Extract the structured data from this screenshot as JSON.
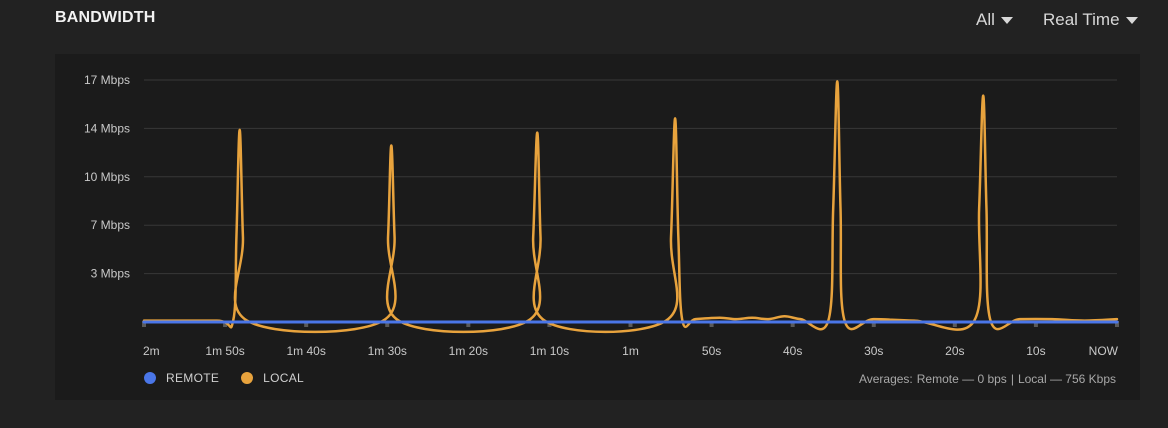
{
  "header": {
    "title": "BANDWIDTH",
    "filter_label": "All",
    "range_label": "Real Time"
  },
  "legend": {
    "remote_label": "REMOTE",
    "local_label": "LOCAL"
  },
  "averages": {
    "prefix": "Averages:",
    "remote": "Remote — 0 bps",
    "separator": "|",
    "local": "Local — 756 Kbps"
  },
  "colors": {
    "remote": "#4a76e8",
    "local": "#e8a33d",
    "grid": "#383838",
    "tick_text": "#c9c9c9"
  },
  "chart_data": {
    "type": "line",
    "xlabel": "",
    "ylabel": "",
    "x_unit": "seconds ago",
    "xlim": [
      120,
      0
    ],
    "ylim": [
      0,
      17
    ],
    "y_ticks": [
      {
        "value": 3.4,
        "label": "3 Mbps"
      },
      {
        "value": 6.8,
        "label": "7 Mbps"
      },
      {
        "value": 10.2,
        "label": "10 Mbps"
      },
      {
        "value": 13.6,
        "label": "14 Mbps"
      },
      {
        "value": 17,
        "label": "17 Mbps"
      }
    ],
    "x_ticks": [
      {
        "value": 120,
        "label": "2m"
      },
      {
        "value": 110,
        "label": "1m 50s"
      },
      {
        "value": 100,
        "label": "1m 40s"
      },
      {
        "value": 90,
        "label": "1m 30s"
      },
      {
        "value": 80,
        "label": "1m 20s"
      },
      {
        "value": 70,
        "label": "1m 10s"
      },
      {
        "value": 60,
        "label": "1m"
      },
      {
        "value": 50,
        "label": "50s"
      },
      {
        "value": 40,
        "label": "40s"
      },
      {
        "value": 30,
        "label": "30s"
      },
      {
        "value": 20,
        "label": "20s"
      },
      {
        "value": 10,
        "label": "10s"
      },
      {
        "value": 0,
        "label": "NOW"
      }
    ],
    "series": [
      {
        "name": "LOCAL",
        "color": "#e8a33d",
        "points": [
          [
            120,
            0.1
          ],
          [
            111,
            0.1
          ],
          [
            109,
            0.1
          ],
          [
            108.6,
            6
          ],
          [
            108.2,
            13.5
          ],
          [
            107.8,
            6
          ],
          [
            107.3,
            0.1
          ],
          [
            90.5,
            0.1
          ],
          [
            89.9,
            6
          ],
          [
            89.5,
            12.4
          ],
          [
            89.1,
            6
          ],
          [
            88.6,
            0.1
          ],
          [
            72.6,
            0.1
          ],
          [
            72.0,
            6
          ],
          [
            71.5,
            13.3
          ],
          [
            71.1,
            6
          ],
          [
            70.6,
            0.1
          ],
          [
            55.6,
            0.1
          ],
          [
            55.0,
            6
          ],
          [
            54.5,
            14.3
          ],
          [
            54.1,
            6
          ],
          [
            53.6,
            0.1
          ],
          [
            52,
            0.2
          ],
          [
            49,
            0.3
          ],
          [
            47,
            0.2
          ],
          [
            45,
            0.3
          ],
          [
            43,
            0.2
          ],
          [
            41,
            0.4
          ],
          [
            39,
            0.2
          ],
          [
            35.6,
            0.1
          ],
          [
            35.0,
            8
          ],
          [
            34.5,
            16.9
          ],
          [
            34.1,
            8
          ],
          [
            33.6,
            0.1
          ],
          [
            30,
            0.2
          ],
          [
            25,
            0.1
          ],
          [
            17.6,
            0.1
          ],
          [
            17.0,
            8
          ],
          [
            16.5,
            15.9
          ],
          [
            16.1,
            8
          ],
          [
            15.6,
            0.1
          ],
          [
            12,
            0.2
          ],
          [
            8,
            0.2
          ],
          [
            4,
            0.1
          ],
          [
            0,
            0.2
          ]
        ]
      },
      {
        "name": "REMOTE",
        "color": "#4a76e8",
        "points": [
          [
            120,
            0
          ],
          [
            0,
            0
          ]
        ]
      }
    ],
    "grid": true,
    "legend_position": "bottom-left"
  }
}
